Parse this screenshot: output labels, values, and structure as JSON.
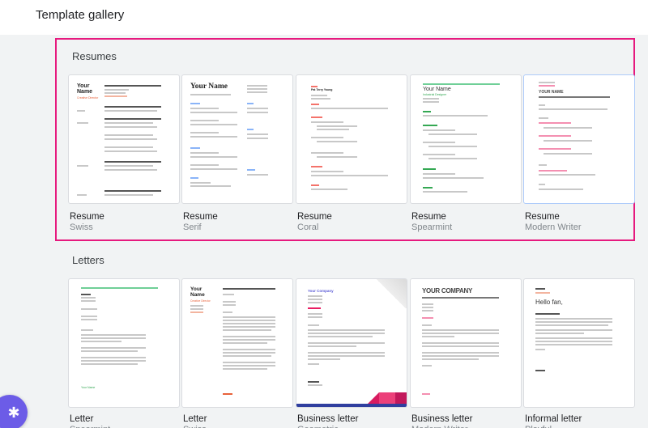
{
  "header": {
    "title": "Template gallery"
  },
  "sections": [
    {
      "title": "Resumes",
      "templates": [
        {
          "type": "Resume",
          "style": "Swiss",
          "thumb_name": "Your Name",
          "thumb_role": "Creative Director",
          "accent": "#e8623a"
        },
        {
          "type": "Resume",
          "style": "Serif",
          "thumb_name": "Your Name",
          "accent": "#4a86e8"
        },
        {
          "type": "Resume",
          "style": "Coral",
          "thumb_name": "Pat Terry Young",
          "accent": "#f4736b"
        },
        {
          "type": "Resume",
          "style": "Spearmint",
          "thumb_name": "Your Name",
          "thumb_role": "Industrial Designer",
          "accent": "#34a853"
        },
        {
          "type": "Resume",
          "style": "Modern Writer",
          "thumb_name": "YOUR NAME",
          "accent": "#e91e63"
        }
      ]
    },
    {
      "title": "Letters",
      "templates": [
        {
          "type": "Letter",
          "style": "Spearmint",
          "thumb_sign": "Your Name",
          "accent": "#34a853"
        },
        {
          "type": "Letter",
          "style": "Swiss",
          "thumb_name": "Your Name",
          "thumb_role": "Creative Director",
          "accent": "#e8623a"
        },
        {
          "type": "Business letter",
          "style": "Geometric",
          "thumb_name": "Your Company",
          "accent": "#e91e63"
        },
        {
          "type": "Business letter",
          "style": "Modern Writer",
          "thumb_name": "YOUR COMPANY",
          "accent": "#e91e63"
        },
        {
          "type": "Informal letter",
          "style": "Playful",
          "thumb_name": "Hello fan,",
          "accent": "#e8623a"
        }
      ]
    }
  ],
  "fab": {
    "icon": "sparkle-icon"
  },
  "colors": {
    "highlight": "#e6197e",
    "background": "#f1f3f4",
    "fab": "#6c5ce7"
  }
}
